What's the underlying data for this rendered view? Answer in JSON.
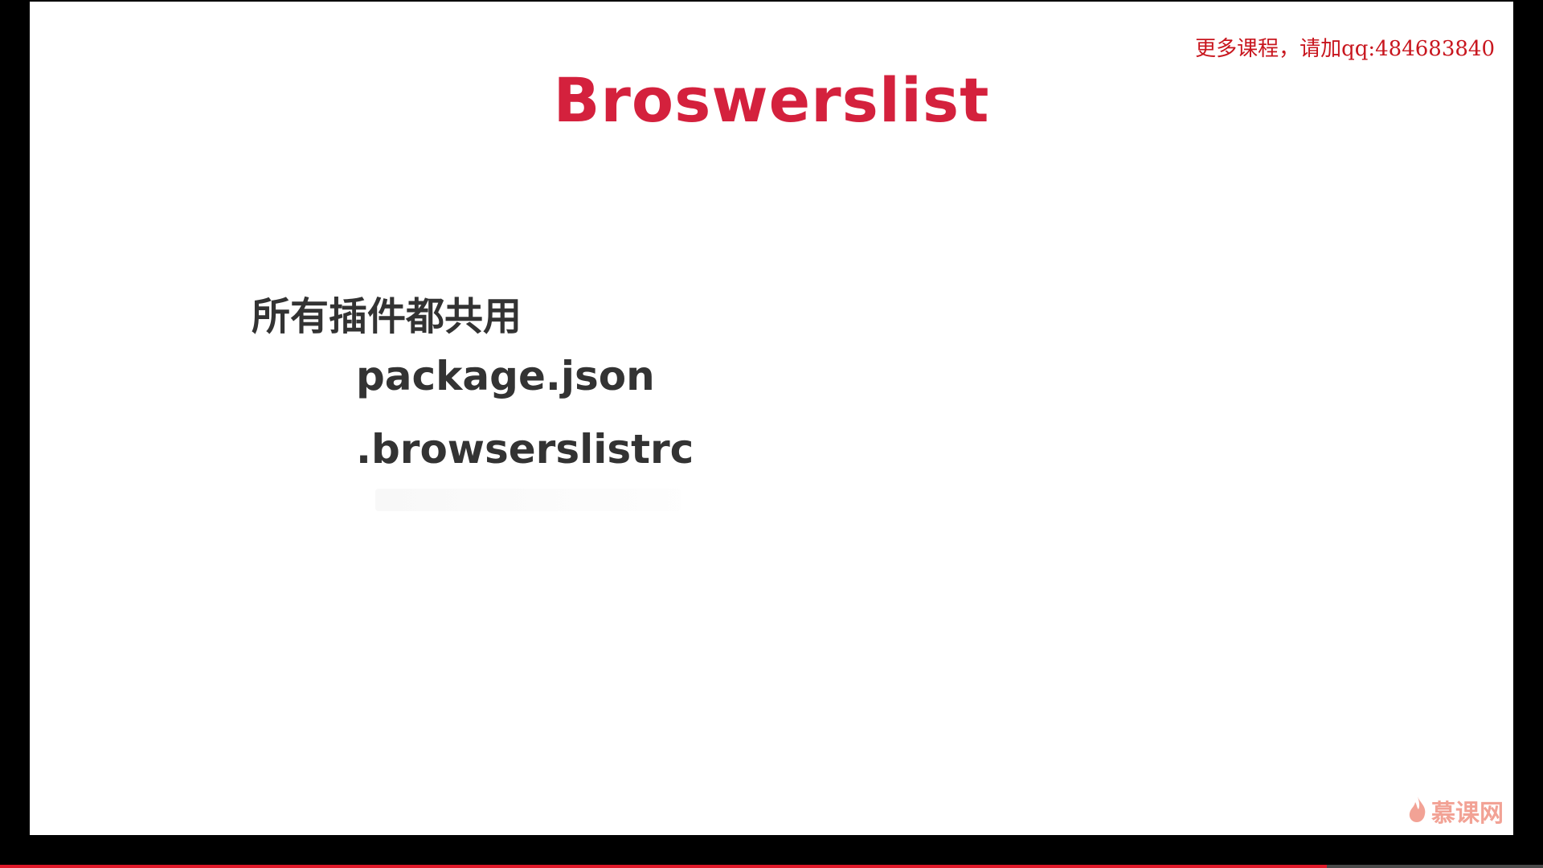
{
  "watermark": {
    "text": "更多课程，请加qq:484683840",
    "color": "#c8161e"
  },
  "slide": {
    "title": "Broswerslist",
    "title_color": "#d4213d",
    "heading": "所有插件都共用",
    "items": [
      {
        "label": "package.json"
      },
      {
        "label": ".browserslistrc"
      }
    ]
  },
  "logo": {
    "text": "慕课网",
    "icon": "flame-icon",
    "color": "#e8573f"
  },
  "player": {
    "progress": 0.86,
    "progress_color": "#e0192a"
  }
}
